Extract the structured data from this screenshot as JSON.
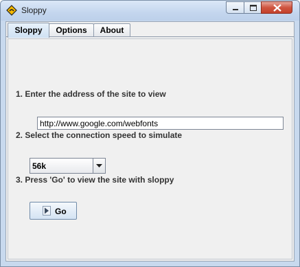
{
  "window": {
    "title": "Sloppy",
    "app_icon": "sloppy-road-sign-icon"
  },
  "tabs": [
    {
      "label": "Sloppy",
      "active": true
    },
    {
      "label": "Options",
      "active": false
    },
    {
      "label": "About",
      "active": false
    }
  ],
  "form": {
    "step1_label": "1. Enter the address of the site to view",
    "url_value": "http://www.google.com/webfonts",
    "step2_label": "2. Select the connection speed to simulate",
    "speed_selected": "56k",
    "step3_label": "3. Press 'Go' to view the site with sloppy",
    "go_label": "Go"
  },
  "colors": {
    "title_bar": "#c4d6ee",
    "panel": "#f0f0f0",
    "close_button": "#c3412c",
    "icon_fill": "#f5b800"
  }
}
